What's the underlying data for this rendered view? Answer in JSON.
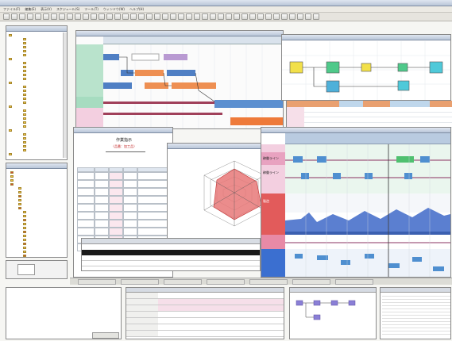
{
  "app": {
    "title": "",
    "menus": [
      "ファイル(F)",
      "編集(E)",
      "表示(V)",
      "スケジュール(S)",
      "ツール(T)",
      "ウィンドウ(W)",
      "ヘルプ(H)"
    ]
  },
  "tree": {
    "items": [
      "",
      "",
      "",
      "",
      "",
      "",
      "",
      "",
      "",
      "",
      "",
      "",
      "",
      "",
      "",
      "",
      "",
      "",
      "",
      "",
      "",
      "",
      "",
      "",
      "",
      "",
      "",
      "",
      "",
      "",
      ""
    ]
  },
  "gantt": {
    "rows": [
      "",
      "",
      "",
      "",
      "",
      "",
      "",
      ""
    ],
    "header_dates": [
      "",
      "",
      "",
      "",
      "",
      "",
      "",
      "",
      "",
      "",
      ""
    ]
  },
  "report": {
    "title": "作業指示",
    "subtitle": "〈品番：加工品〉",
    "columns": [
      "",
      "",
      "",
      "",
      ""
    ],
    "rows": [
      [
        "",
        "",
        "",
        "",
        ""
      ],
      [
        "",
        "",
        "",
        "",
        ""
      ],
      [
        "",
        "",
        "",
        "",
        ""
      ],
      [
        "",
        "",
        "",
        "",
        ""
      ],
      [
        "",
        "",
        "",
        "",
        ""
      ],
      [
        "",
        "",
        "",
        "",
        ""
      ],
      [
        "",
        "",
        "",
        "",
        ""
      ],
      [
        "",
        "",
        "",
        "",
        ""
      ],
      [
        "",
        "",
        "",
        "",
        ""
      ],
      [
        "",
        "",
        "",
        "",
        ""
      ]
    ]
  },
  "radar": {
    "labels": [
      "",
      "",
      "",
      ""
    ]
  },
  "schedule_big": {
    "row_labels": [
      "稼働ライン",
      "稼働ライン",
      "製造",
      "",
      "",
      "",
      "",
      ""
    ]
  },
  "bottom_tabs": [
    "",
    "",
    "",
    "",
    "",
    "",
    ""
  ],
  "bottom_props": {
    "rows": [
      "",
      "",
      "",
      "",
      "",
      "",
      ""
    ]
  },
  "list_right": {
    "rows": [
      "",
      "",
      "",
      "",
      "",
      "",
      "",
      "",
      "",
      "",
      "",
      "",
      ""
    ]
  }
}
